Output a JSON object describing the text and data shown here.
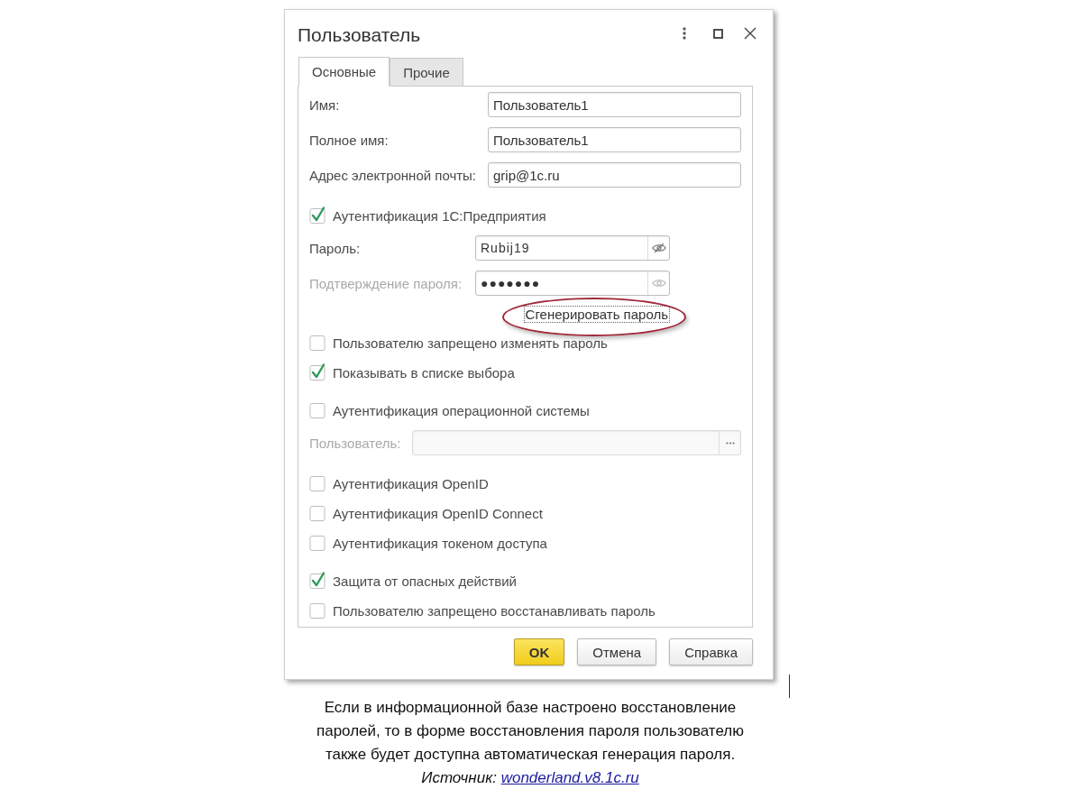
{
  "window": {
    "title": "Пользователь"
  },
  "tabs": [
    {
      "label": "Основные",
      "selected": true
    },
    {
      "label": "Прочие",
      "selected": false
    }
  ],
  "form": {
    "sections": [
      {
        "rows": [
          {
            "kind": "field",
            "label": "Имя:",
            "value": "Пользователь1"
          },
          {
            "kind": "field",
            "label": "Полное имя:",
            "value": "Пользователь1"
          },
          {
            "kind": "field",
            "label": "Адрес электронной почты:",
            "value": "grip@1c.ru"
          }
        ]
      },
      {
        "rows": [
          {
            "kind": "checkbox",
            "label": "Аутентификация 1С:Предприятия",
            "checked": true
          },
          {
            "kind": "password",
            "label": "Пароль:",
            "value": "Rubij19",
            "disabled": false,
            "revealed": true
          },
          {
            "kind": "password",
            "label": "Подтверждение пароля:",
            "value": "●●●●●●●",
            "disabled": true,
            "revealed": false
          },
          {
            "kind": "action",
            "label": "Сгенерировать пароль",
            "focused": true,
            "highlighted": true
          },
          {
            "kind": "checkbox",
            "label": "Пользователю запрещено изменять пароль",
            "checked": false
          },
          {
            "kind": "checkbox",
            "label": "Показывать в списке выбора",
            "checked": true
          }
        ]
      },
      {
        "rows": [
          {
            "kind": "checkbox",
            "label": "Аутентификация операционной системы",
            "checked": false
          },
          {
            "kind": "choice",
            "label": "Пользователь:",
            "disabled": true
          }
        ]
      },
      {
        "rows": [
          {
            "kind": "checkbox",
            "label": "Аутентификация OpenID",
            "checked": false
          },
          {
            "kind": "checkbox",
            "label": "Аутентификация OpenID Connect",
            "checked": false
          },
          {
            "kind": "checkbox",
            "label": "Аутентификация токеном доступа",
            "checked": false
          }
        ]
      },
      {
        "rows": [
          {
            "kind": "checkbox",
            "label": "Защита от опасных действий",
            "checked": true
          },
          {
            "kind": "checkbox",
            "label": "Пользователю запрещено восстанавливать пароль",
            "checked": false
          }
        ]
      }
    ]
  },
  "buttons": [
    {
      "label": "OK",
      "default": true
    },
    {
      "label": "Отмена",
      "default": false
    },
    {
      "label": "Справка",
      "default": false
    }
  ],
  "caption": {
    "text": "Если в информационной базе настроено восстановление паролей, то в форме восстановления пароля пользователю также будет доступна автоматическая генерация пароля.",
    "source_label": "Источник:",
    "source_link": "wonderland.v8.1c.ru"
  }
}
